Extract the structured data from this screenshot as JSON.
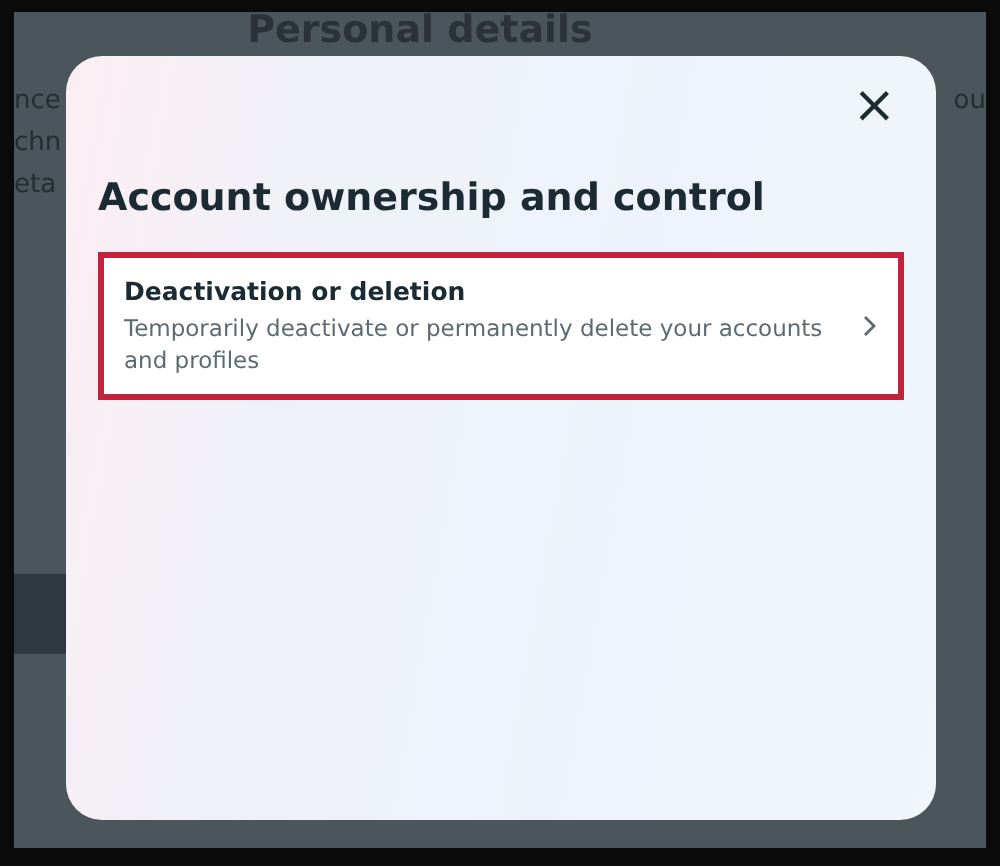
{
  "background": {
    "heading": "Personal details",
    "left_fragments": [
      "nce",
      "chn",
      "eta"
    ],
    "right_fragments": [
      "ou"
    ]
  },
  "dialog": {
    "title": "Account ownership and control",
    "close_label": "×",
    "items": [
      {
        "title": "Deactivation or deletion",
        "description": "Temporarily deactivate or permanently delete your accounts and profiles",
        "selected": true
      }
    ]
  }
}
